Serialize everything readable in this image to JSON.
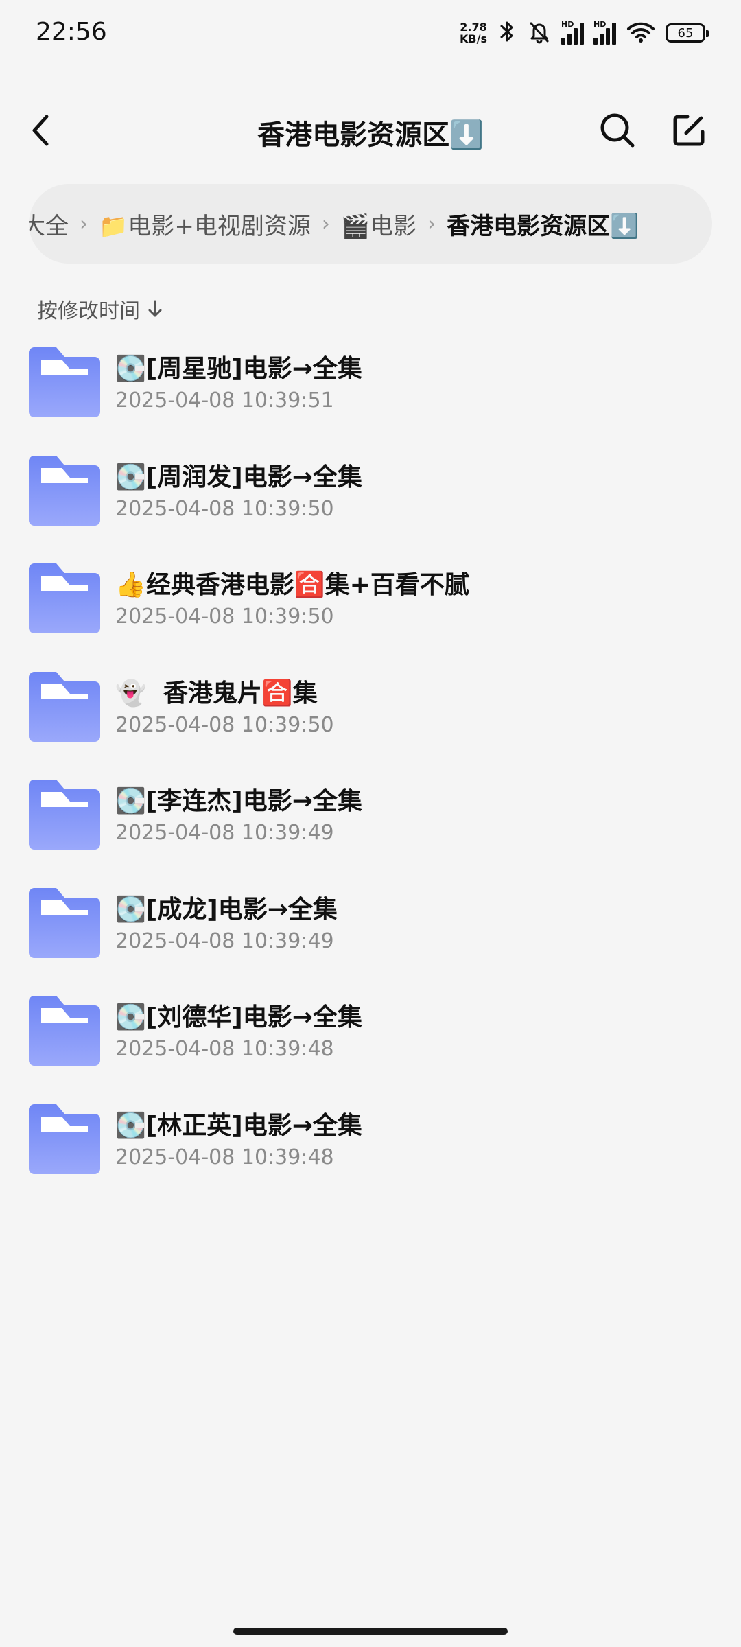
{
  "status_bar": {
    "time": "22:56",
    "net_speed_value": "2.78",
    "net_speed_unit": "KB/s",
    "sim1_label": "HD",
    "sim2_label": "HD",
    "battery": "65",
    "icons": [
      "bluetooth-icon",
      "mute-bell-icon",
      "signal-icon",
      "signal-icon",
      "wifi-icon",
      "battery-icon"
    ]
  },
  "header": {
    "title": "香港电影资源区⬇️",
    "back_icon": "chevron-left-icon",
    "search_icon": "search-icon",
    "edit_icon": "edit-icon"
  },
  "breadcrumb": {
    "items": [
      "大全",
      "📁电影+电视剧资源",
      "🎬电影",
      "香港电影资源区⬇️"
    ]
  },
  "sort": {
    "label": "按修改时间",
    "direction_icon": "arrow-down-icon"
  },
  "files": [
    {
      "name": "💽[周星驰]电影→全集",
      "time": "2025-04-08 10:39:51"
    },
    {
      "name": "💽[周润发]电影→全集",
      "time": "2025-04-08 10:39:50"
    },
    {
      "name": "👍经典香港电影🈴集+百看不腻",
      "time": "2025-04-08 10:39:50"
    },
    {
      "name": "👻  香港鬼片🈴集",
      "time": "2025-04-08 10:39:50"
    },
    {
      "name": "💽[李连杰]电影→全集",
      "time": "2025-04-08 10:39:49"
    },
    {
      "name": "💽[成龙]电影→全集",
      "time": "2025-04-08 10:39:49"
    },
    {
      "name": "💽[刘德华]电影→全集",
      "time": "2025-04-08 10:39:48"
    },
    {
      "name": "💽[林正英]电影→全集",
      "time": "2025-04-08 10:39:48"
    }
  ],
  "colors": {
    "background": "#f5f5f5",
    "folder_top": "#6f86f5",
    "folder_bottom": "#9aa8fb",
    "text_primary": "#111111",
    "text_secondary": "#8a8a8a"
  }
}
